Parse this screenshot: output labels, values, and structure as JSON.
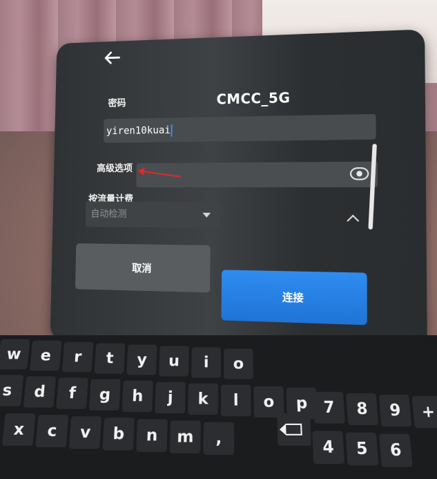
{
  "dialog": {
    "title": "CMCC_5G",
    "password_label": "密码",
    "password_value": "yiren10kuai",
    "advanced_label": "高级选项",
    "metered_label": "按流量计费",
    "metered_value": "自动检测",
    "cancel_label": "取消",
    "connect_label": "连接"
  },
  "keyboard": {
    "row1": [
      "w",
      "e",
      "r",
      "t",
      "y",
      "u",
      "i",
      "o"
    ],
    "row2": [
      "s",
      "d",
      "f",
      "g",
      "h",
      "j",
      "k",
      "l",
      "o",
      "p"
    ],
    "row3": [
      "x",
      "c",
      "v",
      "b",
      "n",
      "m",
      ","
    ],
    "numpad1": [
      "7",
      "8",
      "9",
      "+"
    ],
    "numpad2": [
      "4",
      "5",
      "6"
    ]
  },
  "colors": {
    "accent": "#2f8cf0",
    "annotation_arrow": "#e02a2a"
  }
}
